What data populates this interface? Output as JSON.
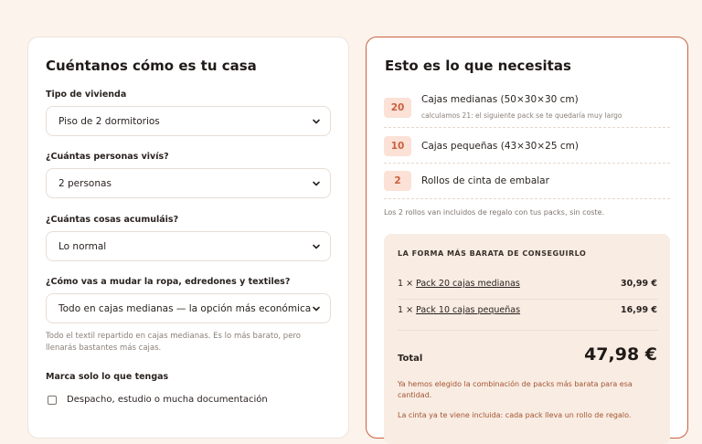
{
  "left_card": {
    "title": "Cuéntanos cómo es tu casa",
    "fields": [
      {
        "label": "Tipo de vivienda",
        "value": "Piso de 2 dormitorios"
      },
      {
        "label": "¿Cuántas personas vivís?",
        "value": "2 personas"
      },
      {
        "label": "¿Cuántas cosas acumuláis?",
        "value": "Lo normal"
      },
      {
        "label": "¿Cómo vas a mudar la ropa, edredones y textiles?",
        "value": "Todo en cajas medianas — la opción más económica"
      }
    ],
    "textile_hint": "Todo el textil repartido en cajas medianas. Es lo más barato, pero llenarás bastantes más cajas.",
    "checkbox_group_label": "Marca solo lo que tengas",
    "checkboxes": [
      {
        "label": "Despacho, estudio o mucha documentación",
        "checked": false
      }
    ]
  },
  "right_card": {
    "title": "Esto es lo que necesitas",
    "items": [
      {
        "qty": "20",
        "label": "Cajas medianas (50×30×30 cm)",
        "sub": "calculamos 21: el siguiente pack se te quedaría muy largo"
      },
      {
        "qty": "10",
        "label": "Cajas pequeñas (43×30×25 cm)"
      },
      {
        "qty": "2",
        "label": "Rollos de cinta de embalar"
      }
    ],
    "tape_note": "Los 2 rollos van incluidos de regalo con tus packs, sin coste.",
    "purchase": {
      "title": "LA FORMA MÁS BARATA DE CONSEGUIRLO",
      "lines": [
        {
          "prefix": "1 × ",
          "link": "Pack 20 cajas medianas",
          "price": "30,99 €"
        },
        {
          "prefix": "1 × ",
          "link": "Pack 10 cajas pequeñas",
          "price": "16,99 €"
        }
      ],
      "total_label": "Total",
      "total_value": "47,98 €",
      "note_1": "Ya hemos elegido la combinación de packs más barata para esa cantidad.",
      "note_2": "La cinta ya te viene incluida: cada pack lleva un rollo de regalo."
    }
  },
  "colors": {
    "accent": "#c9603f",
    "background": "#fbf3ec",
    "badge_bg": "#fbe1d6",
    "summary_bg": "#f8ece3"
  },
  "icons": {
    "select_arrow": "chevron-down-icon"
  }
}
